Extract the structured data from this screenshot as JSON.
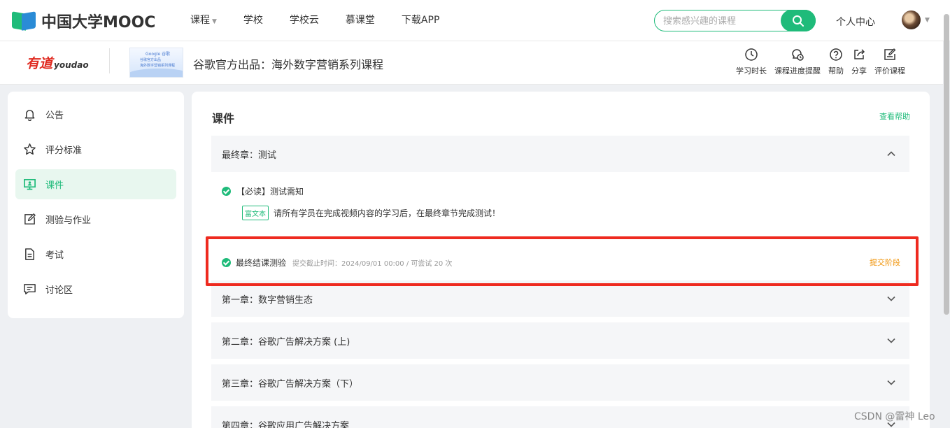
{
  "topbar": {
    "logo": "中国大学MOOC",
    "nav": [
      {
        "label": "课程",
        "has_caret": true
      },
      {
        "label": "学校"
      },
      {
        "label": "学校云"
      },
      {
        "label": "慕课堂"
      },
      {
        "label": "下载APP"
      }
    ],
    "search_placeholder": "搜索感兴趣的课程",
    "personal_center": "个人中心"
  },
  "course_header": {
    "partner_logo_cn": "有道",
    "partner_logo_en": "youdao",
    "thumbnail_text": [
      "Google 谷歌",
      "谷歌官方出品",
      "海外数字营销系列课程"
    ],
    "title": "谷歌官方出品：海外数字营销系列课程",
    "tools": [
      {
        "label": "学习时长",
        "icon": "clock-icon"
      },
      {
        "label": "课程进度提醒",
        "icon": "progress-reminder-icon"
      },
      {
        "label": "帮助",
        "icon": "help-icon"
      },
      {
        "label": "分享",
        "icon": "share-icon"
      },
      {
        "label": "评价课程",
        "icon": "review-icon"
      }
    ]
  },
  "sidebar": {
    "items": [
      {
        "label": "公告",
        "icon": "bell-icon"
      },
      {
        "label": "评分标准",
        "icon": "star-icon"
      },
      {
        "label": "课件",
        "icon": "courseware-icon",
        "active": true
      },
      {
        "label": "测验与作业",
        "icon": "edit-icon"
      },
      {
        "label": "考试",
        "icon": "exam-icon"
      },
      {
        "label": "讨论区",
        "icon": "discussion-icon"
      }
    ]
  },
  "main": {
    "title": "课件",
    "help_link": "查看帮助",
    "chapters": [
      {
        "title": "最终章：测试",
        "expanded": true
      },
      {
        "title": "第一章：数字营销生态",
        "expanded": false
      },
      {
        "title": "第二章：谷歌广告解决方案 (上)",
        "expanded": false
      },
      {
        "title": "第三章：谷歌广告解决方案（下）",
        "expanded": false
      },
      {
        "title": "第四章：谷歌应用广告解决方案",
        "expanded": false
      }
    ],
    "lesson": {
      "title": "【必读】测试需知",
      "tag": "富文本",
      "text": "请所有学员在完成视频内容的学习后，在最终章节完成测试！"
    },
    "quiz": {
      "title": "最终结课测验",
      "meta": "提交截止时间：2024/09/01 00:00 / 可尝试 20 次",
      "stage": "提交阶段"
    }
  },
  "colors": {
    "brand_green": "#1fbb7a",
    "highlight_red": "#ee2a1f",
    "stage_orange": "#f0950c"
  },
  "watermark": "CSDN @雷神 Leo"
}
